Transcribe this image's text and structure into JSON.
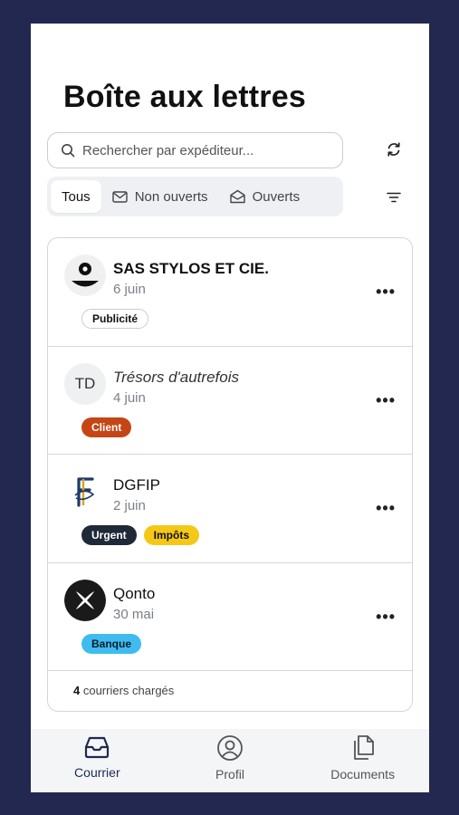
{
  "header": {
    "title": "Boîte aux lettres"
  },
  "search": {
    "placeholder": "Rechercher par expéditeur..."
  },
  "filters": [
    {
      "label": "Tous",
      "active": true
    },
    {
      "label": "Non ouverts",
      "icon": "envelope-icon"
    },
    {
      "label": "Ouverts",
      "icon": "envelope-open-icon"
    }
  ],
  "mails": [
    {
      "sender": "SAS STYLOS ET CIE.",
      "date": "6 juin",
      "style": "bold",
      "tags": [
        "Publicité"
      ]
    },
    {
      "sender": "Trésors d'autrefois",
      "initials": "TD",
      "date": "4 juin",
      "style": "italic",
      "tags": [
        "Client"
      ]
    },
    {
      "sender": "DGFIP",
      "date": "2 juin",
      "style": "normal",
      "tags": [
        "Urgent",
        "Impôts"
      ]
    },
    {
      "sender": "Qonto",
      "date": "30 mai",
      "style": "normal",
      "tags": [
        "Banque"
      ]
    }
  ],
  "footer": {
    "count": "4",
    "count_label": " courriers chargés"
  },
  "nav": [
    {
      "label": "Courrier",
      "icon": "inbox-icon",
      "active": true
    },
    {
      "label": "Profil",
      "icon": "user-circle-icon"
    },
    {
      "label": "Documents",
      "icon": "documents-icon"
    }
  ],
  "more_label": "•••",
  "colors": {
    "background": "#222850",
    "tag_client": "#c54515",
    "tag_urgent": "#1f2937",
    "tag_impots": "#f5c818",
    "tag_banque": "#3ebcf0",
    "nav_active": "#1f2950"
  }
}
